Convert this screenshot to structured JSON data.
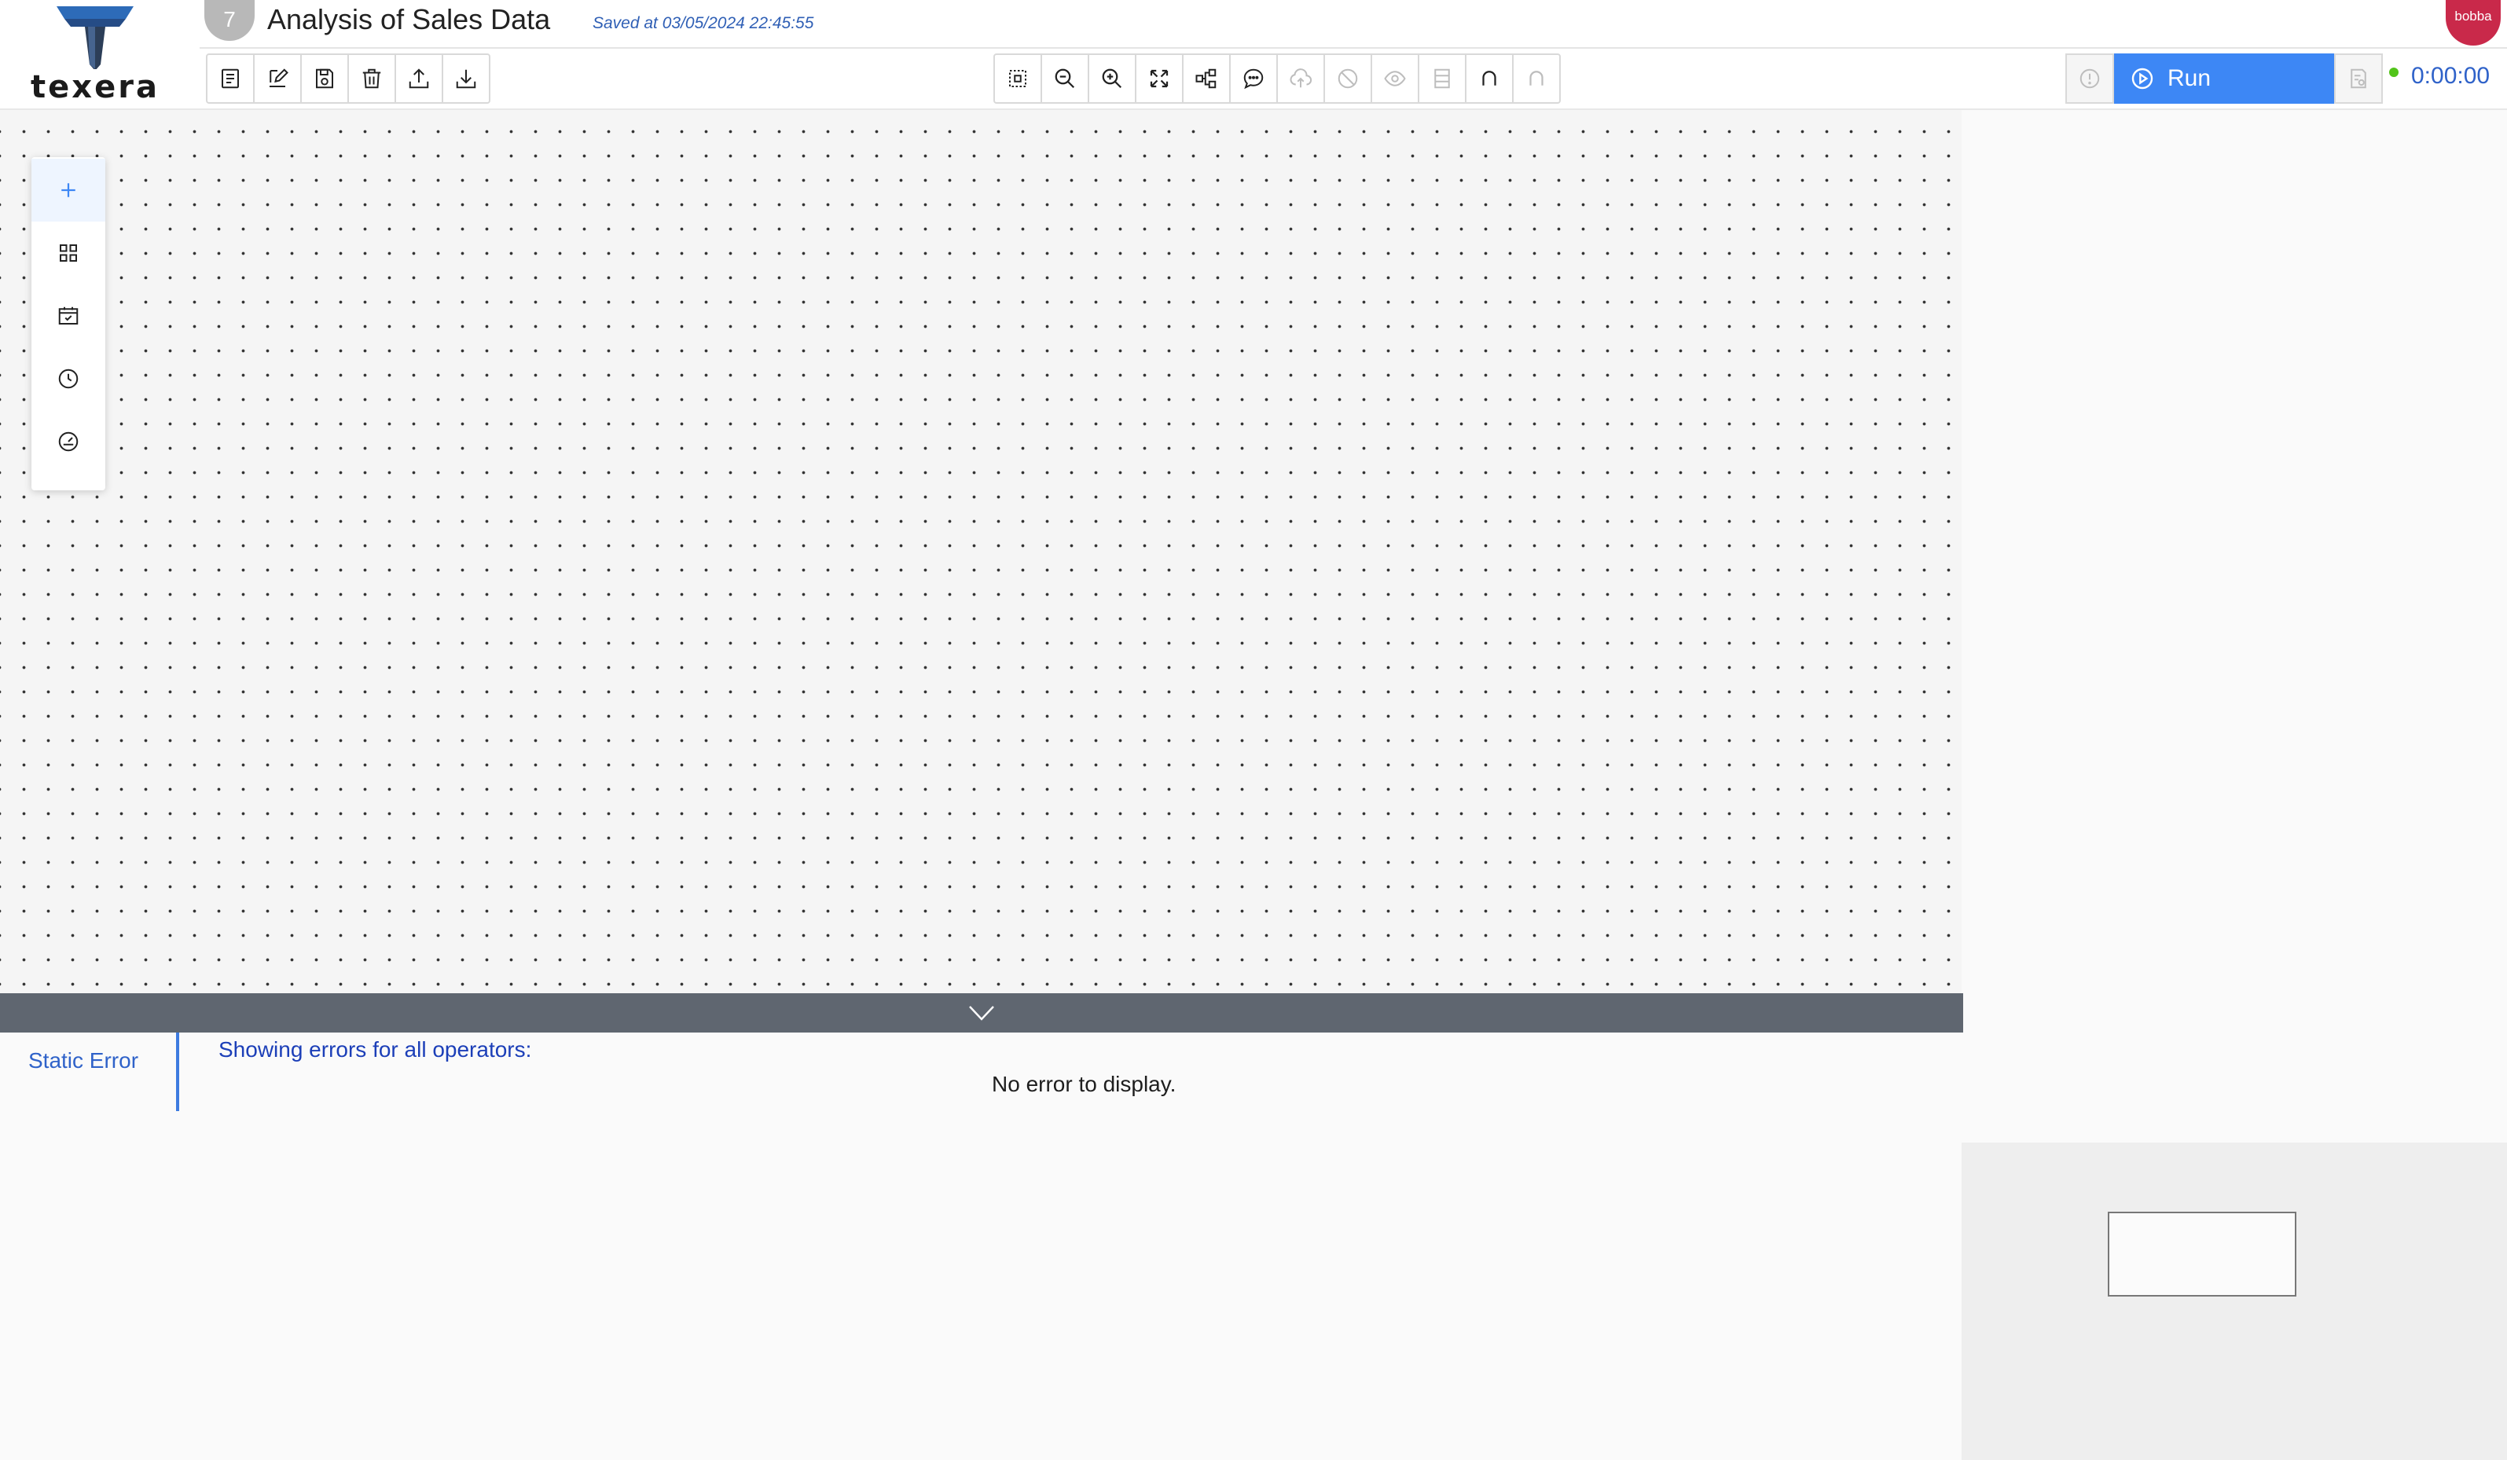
{
  "app": {
    "logo_text": "texera",
    "workflow_id": "7",
    "workflow_title": "Analysis of Sales Data",
    "saved_status": "Saved at 03/05/2024 22:45:55",
    "user_badge": "bobba"
  },
  "toolbar": {
    "left_buttons": [
      {
        "name": "operator-list-icon"
      },
      {
        "name": "edit-icon"
      },
      {
        "name": "save-icon"
      },
      {
        "name": "delete-icon"
      },
      {
        "name": "upload-icon"
      },
      {
        "name": "download-icon"
      }
    ],
    "center_buttons": [
      {
        "name": "fit-to-screen-icon",
        "disabled": false
      },
      {
        "name": "zoom-out-icon",
        "disabled": false
      },
      {
        "name": "zoom-in-icon",
        "disabled": false
      },
      {
        "name": "expand-icon",
        "disabled": false
      },
      {
        "name": "auto-layout-icon",
        "disabled": false
      },
      {
        "name": "comment-icon",
        "disabled": false
      },
      {
        "name": "cloud-upload-icon",
        "disabled": true
      },
      {
        "name": "disable-operator-icon",
        "disabled": true
      },
      {
        "name": "view-result-icon",
        "disabled": true
      },
      {
        "name": "cache-icon",
        "disabled": true
      },
      {
        "name": "undo-icon",
        "disabled": false
      },
      {
        "name": "redo-icon",
        "disabled": true
      }
    ],
    "run_label": "Run",
    "timer": "0:00:00",
    "status_color": "#52c41a",
    "run_color": "#3d87f5"
  },
  "left_panel": {
    "items": [
      {
        "name": "add-operator-icon",
        "active": true
      },
      {
        "name": "grid-icon",
        "active": false
      },
      {
        "name": "calendar-icon",
        "active": false
      },
      {
        "name": "history-icon",
        "active": false
      },
      {
        "name": "dashboard-icon",
        "active": false
      }
    ]
  },
  "bottom_panel": {
    "tab_label": "Static Error",
    "header_text": "Showing errors for all operators:",
    "empty_text": "No error to display."
  }
}
